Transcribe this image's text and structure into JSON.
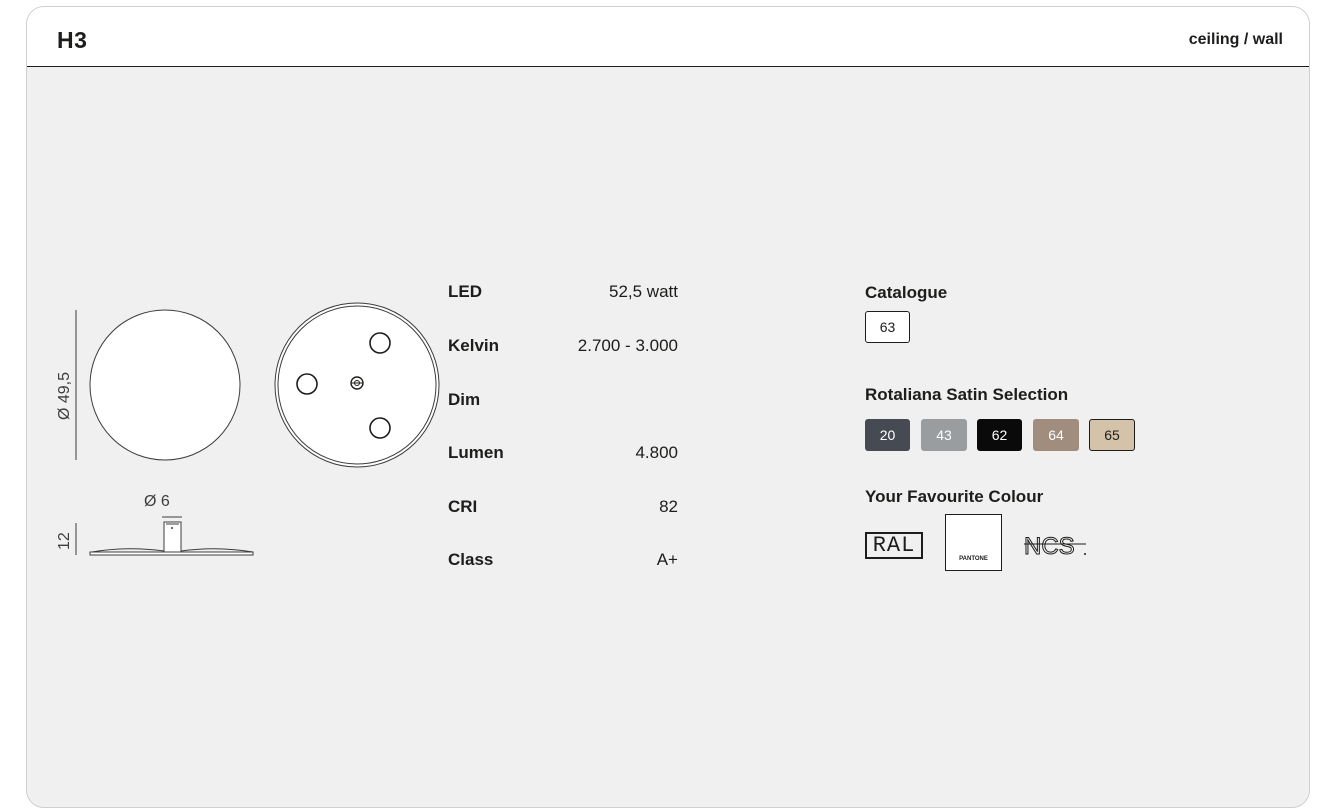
{
  "header": {
    "model": "H3",
    "mount_type": "ceiling / wall"
  },
  "drawing": {
    "diameter_label": "Ø 49,5",
    "stem_diameter_label": "Ø 6",
    "height_label": "12"
  },
  "specs": [
    {
      "label": "LED",
      "value": "52,5 watt"
    },
    {
      "label": "Kelvin",
      "value": "2.700 - 3.000"
    },
    {
      "label": "Dim",
      "value": ""
    },
    {
      "label": "Lumen",
      "value": "4.800"
    },
    {
      "label": "CRI",
      "value": "82"
    },
    {
      "label": "Class",
      "value": "A+"
    }
  ],
  "catalogue": {
    "title": "Catalogue",
    "code": "63"
  },
  "satin_selection": {
    "title": "Rotaliana Satin Selection",
    "swatches": [
      {
        "code": "20",
        "color": "#464b53",
        "text_color": "#ffffff"
      },
      {
        "code": "43",
        "color": "#9a9da0",
        "text_color": "#ffffff"
      },
      {
        "code": "62",
        "color": "#0a0a0a",
        "text_color": "#ffffff"
      },
      {
        "code": "64",
        "color": "#a08d7e",
        "text_color": "#ffffff"
      },
      {
        "code": "65",
        "color": "#d4c3a9",
        "text_color": "#1d1d1b"
      }
    ]
  },
  "favourite_colour": {
    "title": "Your Favourite Colour",
    "ral_label": "RAL",
    "pantone_label": "PANTONE",
    "ncs_label": "NCS"
  }
}
